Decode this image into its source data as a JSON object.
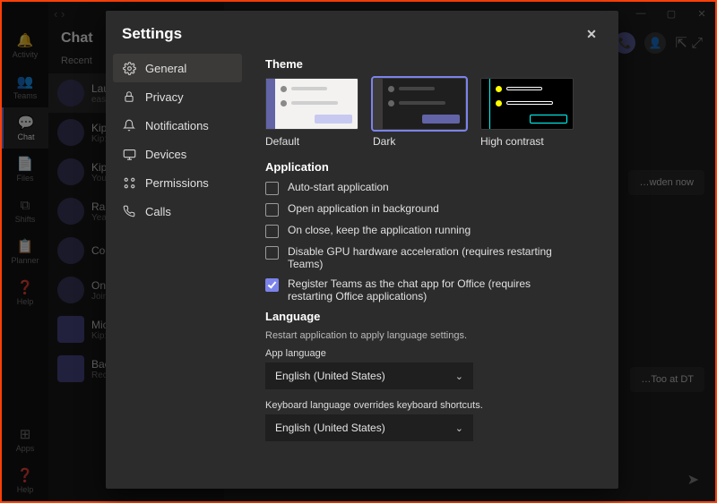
{
  "titlebar": {
    "min": "—",
    "max": "▢",
    "close": "✕"
  },
  "rail": {
    "items": [
      {
        "icon": "🔔",
        "label": "Activity"
      },
      {
        "icon": "💬",
        "label": "Chat"
      },
      {
        "icon": "👥",
        "label": "Teams"
      },
      {
        "icon": "📄",
        "label": "Files"
      },
      {
        "icon": "⧉",
        "label": "Shifts"
      },
      {
        "icon": "📋",
        "label": "Planner"
      },
      {
        "icon": "❓",
        "label": "Help"
      }
    ],
    "bottom": [
      {
        "icon": "⊞",
        "label": "Apps"
      },
      {
        "icon": "❓",
        "label": "Help"
      }
    ]
  },
  "chat": {
    "title": "Chat",
    "tabs": [
      "Recent"
    ],
    "rows": [
      {
        "top": "Laur…",
        "bot": "easy …"
      },
      {
        "top": "Kip a…",
        "bot": "Kip: …"
      },
      {
        "top": "Kip a…",
        "bot": "You: …"
      },
      {
        "top": "Rabi…",
        "bot": "Yeah, …"
      },
      {
        "top": "Cody…",
        "bot": ""
      },
      {
        "top": "OnM…",
        "bot": "Joining …"
      },
      {
        "top": "Micr…",
        "bot": "Kip: y…"
      },
      {
        "top": "Back…",
        "bot": "Recor…"
      }
    ]
  },
  "main": {
    "bubble1": "…wden now",
    "bubble2": "…Too at DT"
  },
  "settings": {
    "title": "Settings",
    "close": "✕",
    "sidebar": [
      {
        "icon": "gear",
        "label": "General"
      },
      {
        "icon": "lock",
        "label": "Privacy"
      },
      {
        "icon": "bell",
        "label": "Notifications"
      },
      {
        "icon": "monitor",
        "label": "Devices"
      },
      {
        "icon": "permissions",
        "label": "Permissions"
      },
      {
        "icon": "phone",
        "label": "Calls"
      }
    ],
    "theme": {
      "heading": "Theme",
      "options": [
        {
          "label": "Default"
        },
        {
          "label": "Dark"
        },
        {
          "label": "High contrast"
        }
      ],
      "selected": "Dark"
    },
    "application": {
      "heading": "Application",
      "items": [
        {
          "label": "Auto-start application",
          "checked": false
        },
        {
          "label": "Open application in background",
          "checked": false
        },
        {
          "label": "On close, keep the application running",
          "checked": false
        },
        {
          "label": "Disable GPU hardware acceleration (requires restarting Teams)",
          "checked": false
        },
        {
          "label": "Register Teams as the chat app for Office (requires restarting Office applications)",
          "checked": true
        }
      ]
    },
    "language": {
      "heading": "Language",
      "subtext": "Restart application to apply language settings.",
      "app_label": "App language",
      "app_value": "English (United States)",
      "kb_label": "Keyboard language overrides keyboard shortcuts.",
      "kb_value": "English (United States)"
    }
  }
}
